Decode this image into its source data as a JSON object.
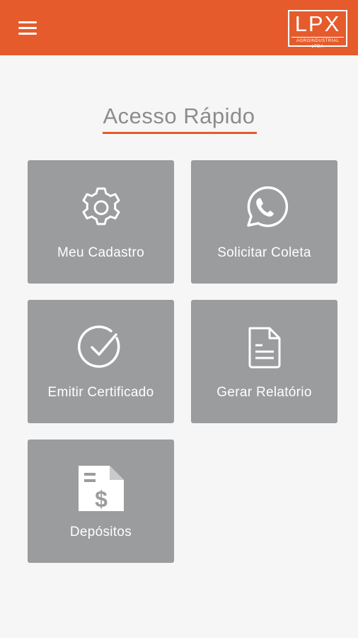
{
  "header": {
    "logo_text": "LPX",
    "logo_subtext": "AGROINDUSTRIAL LTDA",
    "accent_color": "#e55b2c",
    "menu_icon": "hamburger-menu-icon"
  },
  "main": {
    "title": "Acesso Rápido",
    "tiles": [
      {
        "label": "Meu Cadastro",
        "icon": "gear-icon"
      },
      {
        "label": "Solicitar Coleta",
        "icon": "whatsapp-icon"
      },
      {
        "label": "Emitir Certificado",
        "icon": "check-circle-icon"
      },
      {
        "label": "Gerar Relatório",
        "icon": "document-icon"
      },
      {
        "label": "Depósitos",
        "icon": "money-document-icon"
      }
    ]
  }
}
